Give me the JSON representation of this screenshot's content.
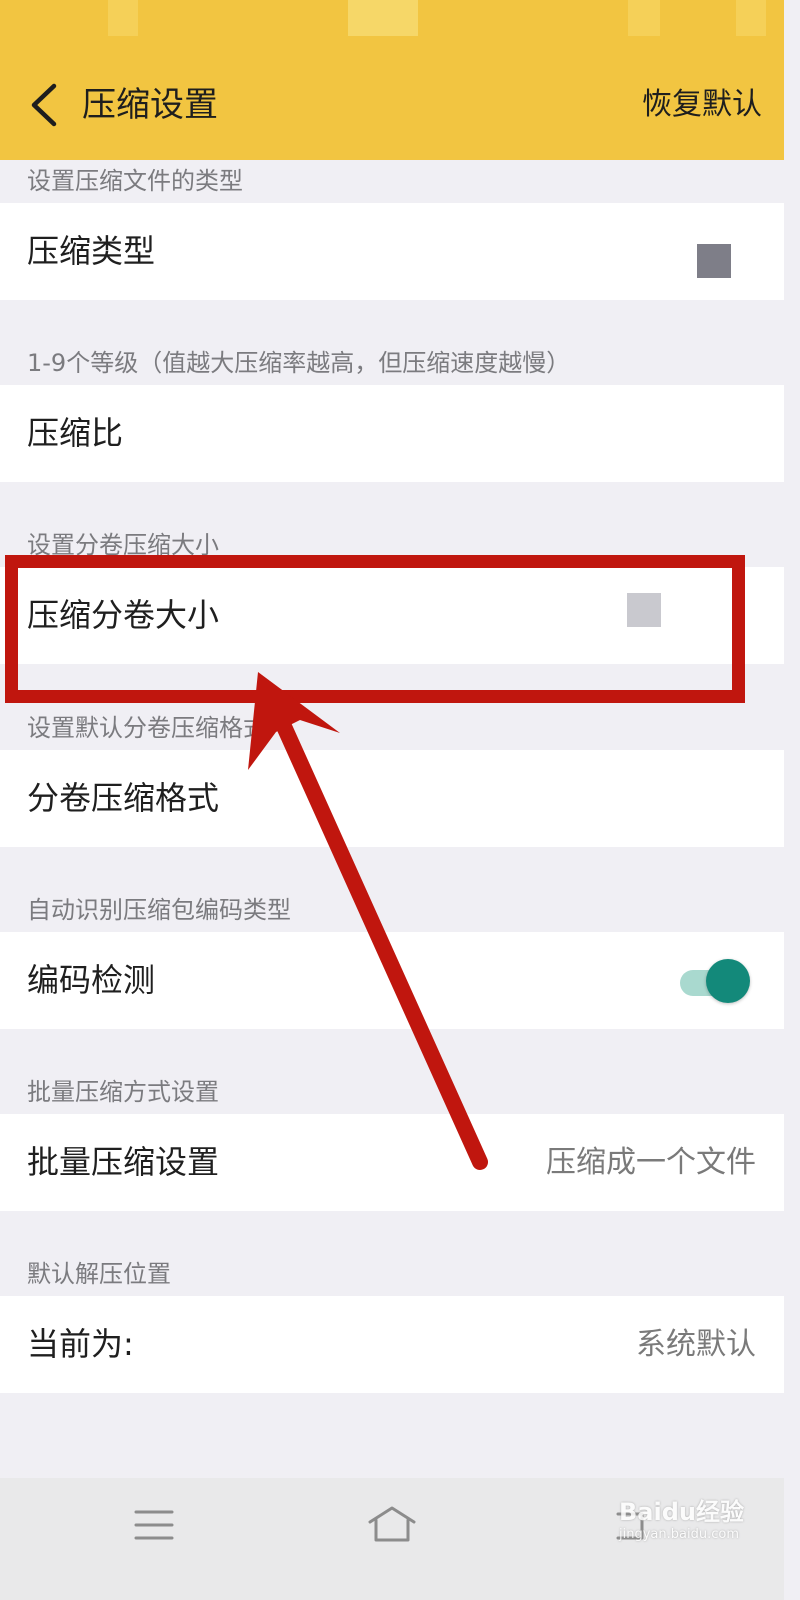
{
  "app_bar": {
    "title": "压缩设置",
    "restore_default_label": "恢复默认",
    "color": "#f2c541"
  },
  "sections": [
    {
      "header": "设置压缩文件的类型",
      "row_label": "压缩类型"
    },
    {
      "header": "1-9个等级（值越大压缩率越高，但压缩速度越慢）",
      "row_label": "压缩比"
    },
    {
      "header": "设置分卷压缩大小",
      "row_label": "压缩分卷大小"
    },
    {
      "header": "设置默认分卷压缩格式",
      "row_label": "分卷压缩格式"
    },
    {
      "header": "自动识别压缩包编码类型",
      "row_label": "编码检测",
      "toggle_on": true
    },
    {
      "header": "批量压缩方式设置",
      "row_label": "批量压缩设置",
      "row_value": "压缩成一个文件"
    },
    {
      "header": "默认解压位置",
      "row_label": "当前为:",
      "row_value": "系统默认"
    }
  ],
  "nav_bar": {
    "icons": [
      "menu-icon",
      "home-icon",
      "back-icon"
    ]
  },
  "annotation": {
    "highlight_color": "#c0160e",
    "highlighted_row": "压缩分卷大小"
  },
  "watermark": {
    "main": "Baidu经验",
    "sub": "jingyan.baidu.com"
  },
  "colors": {
    "toggle_on": "#13897a",
    "background": "#f0eff4"
  }
}
